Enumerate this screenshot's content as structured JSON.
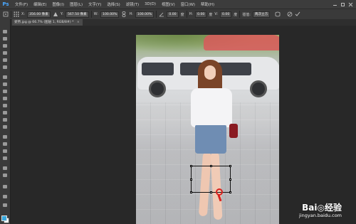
{
  "app": {
    "logo": "Ps"
  },
  "menu": [
    "文件(F)",
    "编辑(E)",
    "图像(I)",
    "图层(L)",
    "文字(Y)",
    "选择(S)",
    "滤镜(T)",
    "3D(D)",
    "视图(V)",
    "窗口(W)",
    "帮助(H)"
  ],
  "options": {
    "x_label": "X:",
    "x_value": "356.00 像素",
    "y_label": "Y:",
    "y_value": "567.50 像素",
    "w_label": "W:",
    "w_value": "100.00%",
    "h_label": "H:",
    "h_value": "100.00%",
    "angle_value": "0.00",
    "h_skew_label": "H:",
    "h_skew_value": "0.00",
    "v_skew_label": "V:",
    "v_skew_value": "0.00",
    "interp_label": "插值:",
    "interp_value": "两次立方"
  },
  "document": {
    "tab_label": "姿势.jpg @ 66.7% (图层 1, RGB/8#) *",
    "close": "×"
  },
  "colors": {
    "foreground": "#38a7dc",
    "background": "#ffffff",
    "annotation": "#d8211e"
  },
  "watermark": {
    "logo": "Bai◎经验",
    "url": "jingyan.baidu.com"
  }
}
